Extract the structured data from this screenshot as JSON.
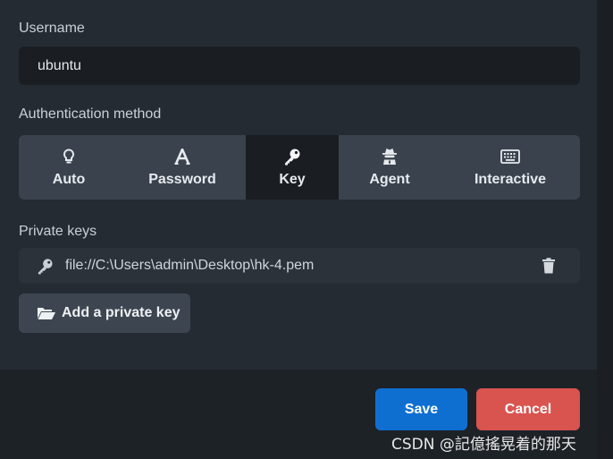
{
  "username": {
    "label": "Username",
    "value": "ubuntu"
  },
  "auth": {
    "label": "Authentication method",
    "options": [
      {
        "label": "Auto",
        "icon": "lightbulb-icon"
      },
      {
        "label": "Password",
        "icon": "font-a-icon"
      },
      {
        "label": "Key",
        "icon": "key-icon"
      },
      {
        "label": "Agent",
        "icon": "user-secret-icon"
      },
      {
        "label": "Interactive",
        "icon": "keyboard-icon"
      }
    ],
    "selected": "Key"
  },
  "private_keys": {
    "label": "Private keys",
    "items": [
      {
        "path": "file://C:\\Users\\admin\\Desktop\\hk-4.pem"
      }
    ],
    "add_label": "Add a private key"
  },
  "footer": {
    "save_label": "Save",
    "cancel_label": "Cancel"
  },
  "watermark": "CSDN @記億搖晃着的那天",
  "colors": {
    "panel": "#252b32",
    "field": "#1a1e23",
    "save": "#0f6fd1",
    "cancel": "#d9534f",
    "selected_tab": "#1a1d22"
  }
}
